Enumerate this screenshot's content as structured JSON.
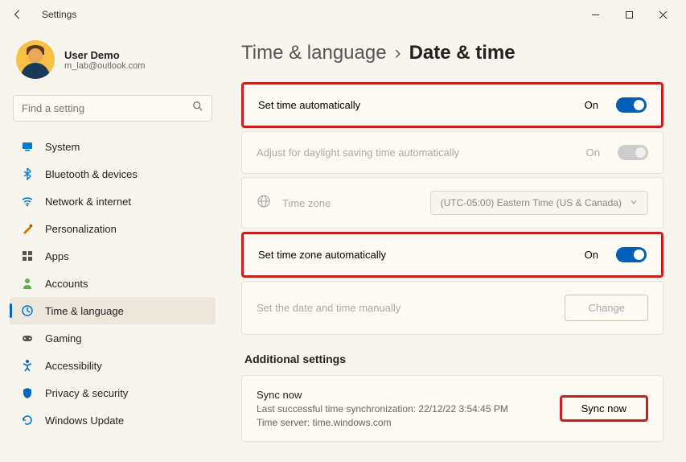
{
  "titlebar": {
    "title": "Settings"
  },
  "user": {
    "name": "User Demo",
    "email": "m_lab@outlook.com"
  },
  "search": {
    "placeholder": "Find a setting"
  },
  "nav": {
    "items": [
      {
        "label": "System",
        "icon": "system"
      },
      {
        "label": "Bluetooth & devices",
        "icon": "bluetooth"
      },
      {
        "label": "Network & internet",
        "icon": "wifi"
      },
      {
        "label": "Personalization",
        "icon": "brush"
      },
      {
        "label": "Apps",
        "icon": "apps"
      },
      {
        "label": "Accounts",
        "icon": "person"
      },
      {
        "label": "Time & language",
        "icon": "clock"
      },
      {
        "label": "Gaming",
        "icon": "game"
      },
      {
        "label": "Accessibility",
        "icon": "accessibility"
      },
      {
        "label": "Privacy & security",
        "icon": "shield"
      },
      {
        "label": "Windows Update",
        "icon": "update"
      }
    ],
    "active_index": 6
  },
  "breadcrumb": {
    "parent": "Time & language",
    "current": "Date & time"
  },
  "settings": {
    "auto_time": {
      "label": "Set time automatically",
      "state": "On"
    },
    "dst": {
      "label": "Adjust for daylight saving time automatically",
      "state": "On"
    },
    "timezone": {
      "label": "Time zone",
      "value": "(UTC-05:00) Eastern Time (US & Canada)"
    },
    "auto_tz": {
      "label": "Set time zone automatically",
      "state": "On"
    },
    "manual": {
      "label": "Set the date and time manually",
      "button": "Change"
    }
  },
  "additional": {
    "heading": "Additional settings",
    "sync": {
      "title": "Sync now",
      "line1": "Last successful time synchronization: 22/12/22 3:54:45 PM",
      "line2": "Time server: time.windows.com",
      "button": "Sync now"
    }
  }
}
